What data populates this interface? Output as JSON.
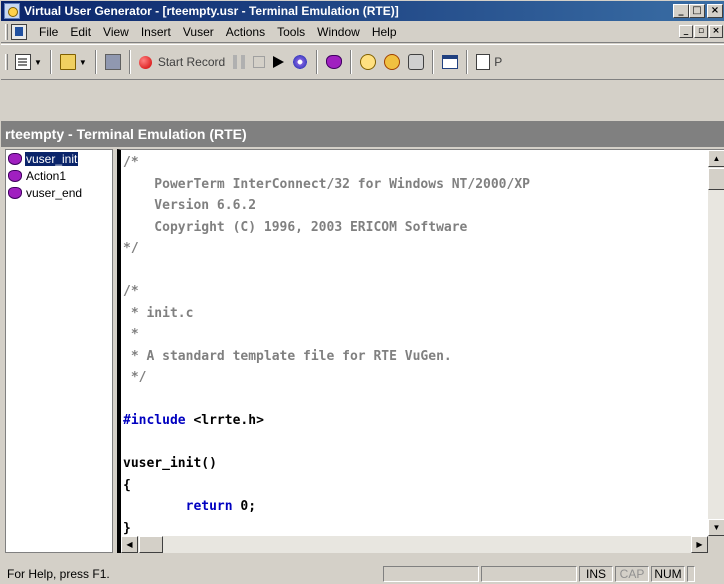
{
  "window": {
    "title": "Virtual User Generator - [rteempty.usr - Terminal Emulation (RTE)]",
    "buttons": {
      "minimize": "_",
      "maximize": "□",
      "close": "×"
    }
  },
  "menubar": {
    "items": [
      "File",
      "Edit",
      "View",
      "Insert",
      "Vuser",
      "Actions",
      "Tools",
      "Window",
      "Help"
    ],
    "mdi": {
      "minimize": "_",
      "restore": "▫",
      "close": "×"
    }
  },
  "toolbar": {
    "start_record": "Start Record",
    "truncated_label": "P",
    "icons": [
      "new-icon",
      "open-icon",
      "save-icon",
      "record-icon",
      "pause-icon",
      "stop-icon",
      "run-icon",
      "compile-icon",
      "vuser-icon",
      "clock-icon",
      "clock2-icon",
      "db-icon",
      "window-icon",
      "page-icon"
    ]
  },
  "document": {
    "title": "rteempty - Terminal Emulation (RTE)"
  },
  "tree": {
    "items": [
      {
        "label": "vuser_init",
        "selected": true
      },
      {
        "label": "Action1",
        "selected": false
      },
      {
        "label": "vuser_end",
        "selected": false
      }
    ]
  },
  "editor": {
    "lines": [
      {
        "t": "/*",
        "c": "cm"
      },
      {
        "t": "    PowerTerm InterConnect/32 for Windows NT/2000/XP",
        "c": "cm"
      },
      {
        "t": "    Version 6.6.2",
        "c": "cm"
      },
      {
        "t": "    Copyright (C) 1996, 2003 ERICOM Software",
        "c": "cm"
      },
      {
        "t": "*/",
        "c": "cm"
      },
      {
        "t": "",
        "c": "cm"
      },
      {
        "t": "/*",
        "c": "cm"
      },
      {
        "t": " * init.c",
        "c": "cm"
      },
      {
        "t": " *",
        "c": "cm"
      },
      {
        "t": " * A standard template file for RTE VuGen.",
        "c": "cm"
      },
      {
        "t": " */",
        "c": "cm"
      },
      {
        "t": "",
        "c": "cm"
      },
      {
        "t": "#include",
        "c": "kw",
        "rest": " <lrrte.h>"
      },
      {
        "t": "",
        "c": "cm"
      },
      {
        "t": "vuser_init()",
        "c": "pl"
      },
      {
        "t": "{",
        "c": "pl"
      },
      {
        "t": "        ",
        "c": "pl",
        "kwrest": "return",
        "rest": " 0;"
      },
      {
        "t": "}",
        "c": "pl"
      }
    ]
  },
  "statusbar": {
    "help": "For Help, press F1.",
    "ins": "INS",
    "cap": "CAP",
    "num": "NUM"
  }
}
